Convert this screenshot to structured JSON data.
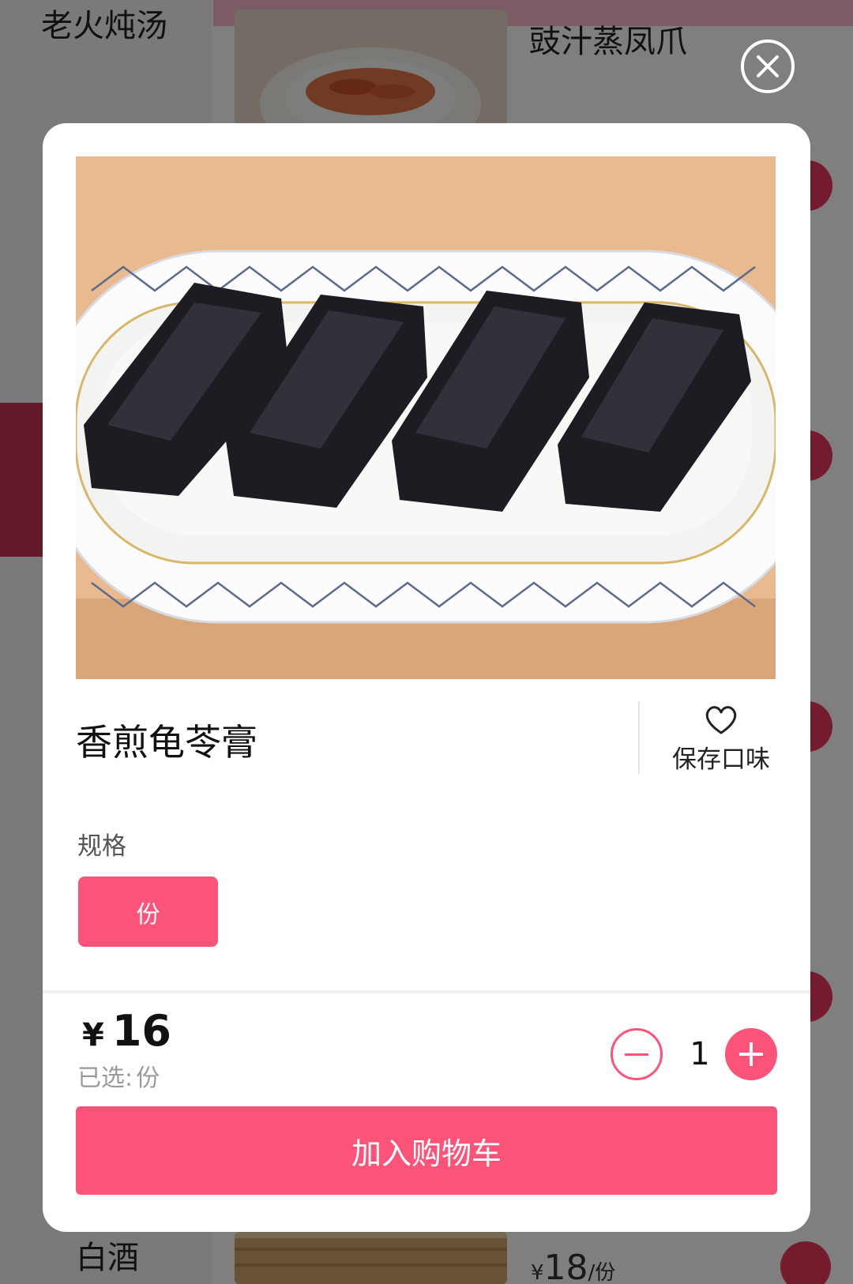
{
  "background": {
    "categories": [
      {
        "label": "老火炖汤"
      },
      {
        "label": "白酒"
      }
    ],
    "dishes": [
      {
        "name": "豉汁蒸凤爪"
      }
    ],
    "bottom_price": {
      "symbol": "¥",
      "amount": "18",
      "unit": "/份"
    }
  },
  "modal": {
    "dish_name": "香煎龟苓膏",
    "favorite_label": "保存口味",
    "spec": {
      "title": "规格",
      "options": [
        {
          "label": "份",
          "selected": true
        }
      ]
    },
    "price": {
      "symbol": "¥",
      "amount": "16"
    },
    "selected": {
      "prefix": "已选:",
      "value": "份"
    },
    "quantity": "1",
    "add_to_cart_label": "加入购物车"
  },
  "colors": {
    "accent": "#fb5478",
    "accent_dark": "#e8375c",
    "overlay": "rgba(0,0,0,0.5)"
  },
  "icons": {
    "close": "close-icon",
    "favorite": "heart-icon",
    "decrement": "minus-icon",
    "increment": "plus-icon"
  }
}
